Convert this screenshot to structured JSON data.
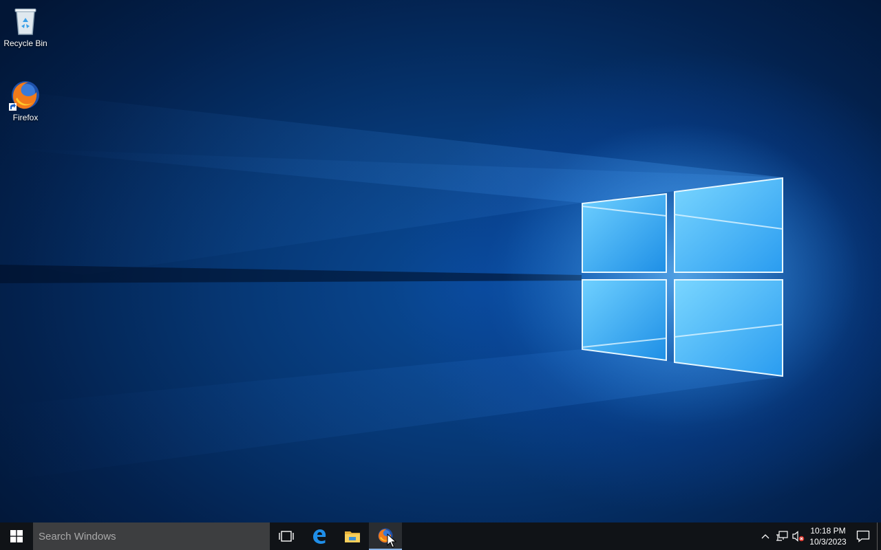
{
  "desktop": {
    "icons": [
      {
        "label": "Recycle Bin",
        "icon": "recycle-bin-icon"
      },
      {
        "label": "Firefox",
        "icon": "firefox-icon",
        "shortcut": true
      }
    ],
    "wallpaper": "windows-10-hero-light-window"
  },
  "taskbar": {
    "start": {
      "icon": "windows-logo-icon"
    },
    "search": {
      "placeholder": "Search Windows"
    },
    "pinned": [
      {
        "icon": "task-view-icon"
      },
      {
        "icon": "edge-icon"
      },
      {
        "icon": "file-explorer-icon"
      },
      {
        "icon": "firefox-icon",
        "running": true
      }
    ],
    "tray": {
      "icons": [
        "chevron-up-icon",
        "network-icon",
        "volume-muted-icon"
      ],
      "time": "10:18 PM",
      "date": "10/3/2023",
      "action_center_icon": "notification-icon"
    }
  },
  "colors": {
    "taskbar_bg": "#101317",
    "search_bg": "#3d3e40",
    "accent": "#1a8cff"
  }
}
